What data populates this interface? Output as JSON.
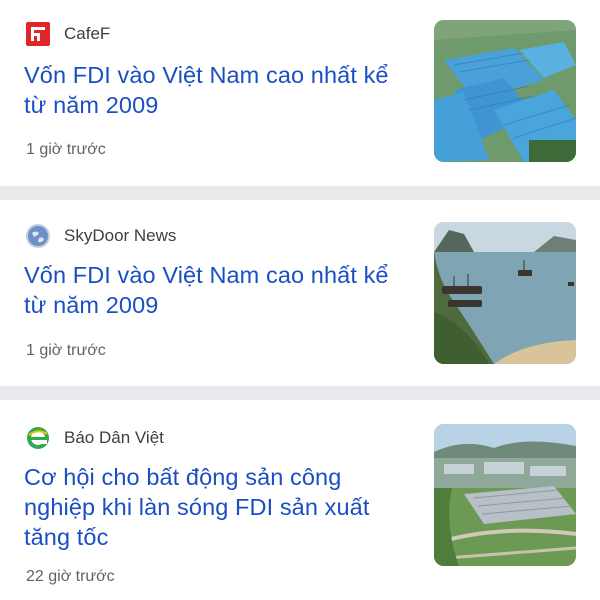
{
  "articles": [
    {
      "source": "CafeF",
      "source_icon": "cafef-logo-icon",
      "title": "Vốn FDI vào Việt Nam cao nhất kể từ năm 2009",
      "time": "1 giờ trước",
      "image": "industrial-park-aerial-image"
    },
    {
      "source": "SkyDoor News",
      "source_icon": "globe-icon",
      "title": "Vốn FDI vào Việt Nam cao nhất kể từ năm 2009",
      "time": "1 giờ trước",
      "image": "bay-with-boats-image"
    },
    {
      "source": "Báo Dân Việt",
      "source_icon": "dan-viet-logo-icon",
      "title": "Cơ hội cho bất động sản công nghiệp khi làn sóng FDI sản xuất tăng tốc",
      "time": "22 giờ trước",
      "image": "industrial-zone-landscape-image"
    }
  ],
  "colors": {
    "headline": "#1a4fc4",
    "source": "#3c4043",
    "time": "#5f6368",
    "divider": "#e8eaed",
    "cafef_red": "#e0262b"
  }
}
